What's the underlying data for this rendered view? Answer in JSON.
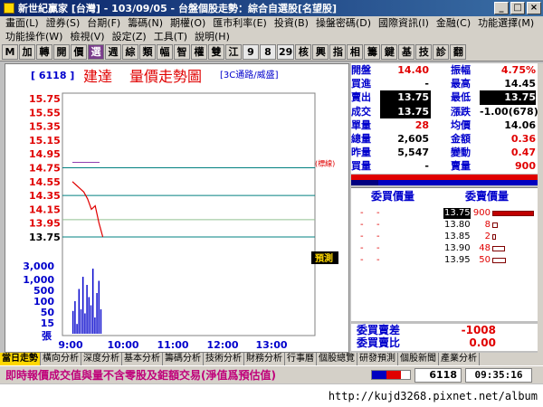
{
  "window": {
    "title": "新世紀贏家 [台灣] - 103/09/05 - 台盤個股走勢：綜合自選股[名望股]"
  },
  "menu": [
    "畫面(L)",
    "證券(S)",
    "台期(F)",
    "籌碼(N)",
    "期權(O)",
    "匯市利率(E)",
    "投資(B)",
    "操盤密碼(D)",
    "國際資訊(I)",
    "金融(C)",
    "功能選擇(M)",
    "功能操作(W)",
    "檢視(V)",
    "設定(Z)",
    "工具(T)",
    "說明(H)"
  ],
  "toolbar": [
    "M",
    "加",
    "轉",
    "開",
    "價",
    "選",
    "週",
    "綜",
    "類",
    "幅",
    "智",
    "權",
    "雙",
    "江",
    "9",
    "8",
    "29",
    "核",
    "興",
    "指",
    "相",
    "籌",
    "鍵",
    "基",
    "技",
    "診",
    "翻"
  ],
  "chart": {
    "code": "[ 6118 ]",
    "name": "建達",
    "title": "量價走勢圖",
    "subtitle": "[3C通路/威盛]",
    "yticks": [
      "15.75",
      "15.55",
      "15.35",
      "15.15",
      "14.95",
      "14.75",
      "14.55",
      "14.35",
      "14.15",
      "13.95",
      "13.75"
    ],
    "vol_ticks": [
      "3,000",
      "1,000",
      "500",
      "100",
      "50",
      "15"
    ],
    "vol_unit": "張",
    "xticks": [
      "9:00",
      "10:00",
      "11:00",
      "12:00",
      "13:00"
    ],
    "ref_label": "(標線)",
    "tag": "預測",
    "colors": {
      "up": "#e00000",
      "down": "#008000",
      "ref": "#008080",
      "price": "#e00000"
    }
  },
  "chart_data": {
    "type": "line",
    "title": "量價走勢圖",
    "x": [
      "9:00",
      "9:05",
      "9:10",
      "9:15",
      "9:20",
      "9:25",
      "9:30",
      "9:35",
      "9:40"
    ],
    "series": [
      {
        "name": "price",
        "values": [
          14.55,
          14.5,
          14.45,
          14.4,
          14.3,
          14.15,
          14.2,
          13.95,
          13.75
        ]
      }
    ],
    "ylim": [
      13.75,
      15.75
    ],
    "reference": 14.75
  },
  "quote": {
    "rows": [
      {
        "l1": "開盤",
        "v1": "14.40",
        "c1": "red",
        "l2": "振幅",
        "v2": "4.75%",
        "c2": "red"
      },
      {
        "l1": "買進",
        "v1": "-",
        "c1": "",
        "l2": "最高",
        "v2": "14.45",
        "c2": "black"
      },
      {
        "l1": "賣出",
        "v1": "13.75",
        "c1": "box",
        "l2": "最低",
        "v2": "13.75",
        "c2": "box"
      },
      {
        "l1": "成交",
        "v1": "13.75",
        "c1": "box",
        "l2": "漲跌",
        "v2": "-1.00(678)",
        "c2": "black"
      },
      {
        "l1": "單量",
        "v1": "28",
        "c1": "red",
        "l2": "均價",
        "v2": "14.06",
        "c2": "black"
      },
      {
        "l1": "總量",
        "v1": "2,605",
        "c1": "",
        "l2": "金額",
        "v2": "0.36",
        "c2": "red"
      },
      {
        "l1": "昨量",
        "v1": "5,547",
        "c1": "",
        "l2": "變動",
        "v2": "0.47",
        "c2": "red"
      },
      {
        "l1": "買量",
        "v1": "-",
        "c1": "",
        "l2": "賣量",
        "v2": "900",
        "c2": "red"
      }
    ]
  },
  "book": {
    "bid_head": "委買價量",
    "ask_head": "委賣價量",
    "asks": [
      {
        "price": "13.75",
        "vol": "900",
        "bar": 1.0
      },
      {
        "price": "13.80",
        "vol": "8",
        "bar": 0.14
      },
      {
        "price": "13.85",
        "vol": "2",
        "bar": 0.08
      },
      {
        "price": "13.90",
        "vol": "48",
        "bar": 0.3
      },
      {
        "price": "13.95",
        "vol": "50",
        "bar": 0.32
      }
    ]
  },
  "diff": {
    "l1": "委買賣差",
    "v1": "-1008",
    "l2": "委買賣比",
    "v2": "0.00"
  },
  "tabs": [
    "當日走勢",
    "橫向分析",
    "深度分析",
    "基本分析",
    "籌碼分析",
    "技術分析",
    "財務分析",
    "行事曆",
    "個股總覽",
    "研發預測",
    "個股新聞",
    "產業分析"
  ],
  "status": {
    "message": "即時報價成交值與量不含零股及鉅額交易(淨值爲預估值)",
    "code": "6118",
    "time": "09:35:16"
  },
  "footer": {
    "url": "http://kujd3268.pixnet.net/album"
  }
}
